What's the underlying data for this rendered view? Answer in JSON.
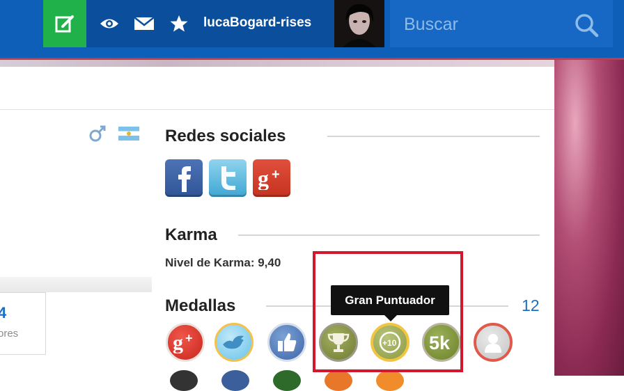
{
  "header": {
    "username": "lucaBogard-rises",
    "search_placeholder": "Buscar",
    "icons": [
      "edit-post-icon",
      "eye-icon",
      "mail-icon",
      "star-icon",
      "search-icon"
    ],
    "colors": {
      "bar": "#0e5fb8",
      "post_button": "#21b14a",
      "accent_line": "#c33a4a"
    }
  },
  "profile": {
    "stat_value": "4",
    "stat_label": "ores"
  },
  "sections": {
    "social": {
      "title": "Redes sociales",
      "buttons": [
        "facebook",
        "twitter",
        "google-plus"
      ]
    },
    "karma": {
      "title": "Karma",
      "text": "Nivel de Karma: 9,40"
    },
    "medals": {
      "title": "Medallas",
      "count": "12",
      "tooltip": "Gran Puntuador",
      "items": [
        {
          "name": "google-plus",
          "glyph": "g+"
        },
        {
          "name": "twitter",
          "glyph": ""
        },
        {
          "name": "like",
          "glyph": ""
        },
        {
          "name": "trophy",
          "glyph": ""
        },
        {
          "name": "gran-puntuador",
          "glyph": "+10"
        },
        {
          "name": "5k",
          "glyph": "5k"
        },
        {
          "name": "user",
          "glyph": ""
        }
      ]
    }
  }
}
